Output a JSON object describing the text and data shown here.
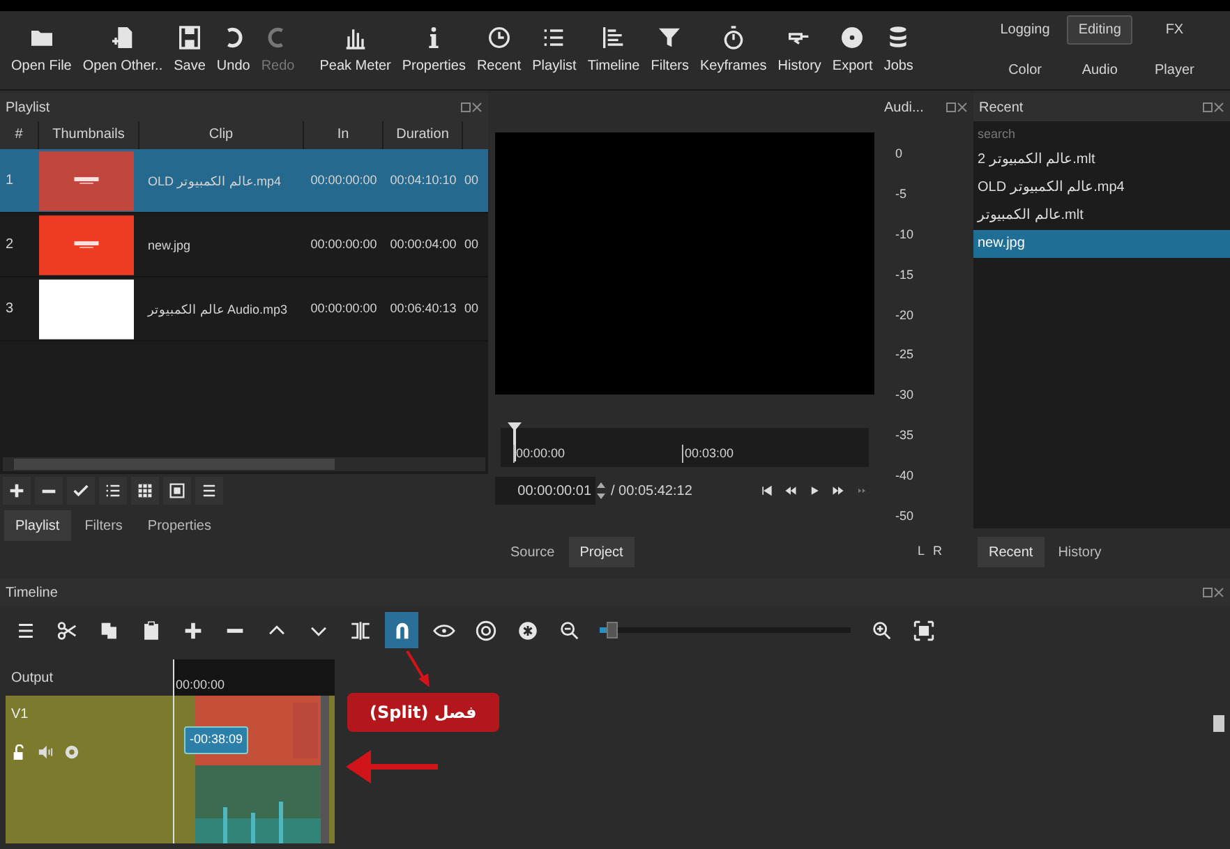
{
  "toolbar": [
    {
      "label": "Open File",
      "disabled": false
    },
    {
      "label": "Open Other..",
      "disabled": false
    },
    {
      "label": "Save",
      "disabled": false
    },
    {
      "label": "Undo",
      "disabled": false
    },
    {
      "label": "Redo",
      "disabled": true
    },
    {
      "label": "Peak Meter",
      "disabled": false
    },
    {
      "label": "Properties",
      "disabled": false
    },
    {
      "label": "Recent",
      "disabled": false
    },
    {
      "label": "Playlist",
      "disabled": false
    },
    {
      "label": "Timeline",
      "disabled": false
    },
    {
      "label": "Filters",
      "disabled": false
    },
    {
      "label": "Keyframes",
      "disabled": false
    },
    {
      "label": "History",
      "disabled": false
    },
    {
      "label": "Export",
      "disabled": false
    },
    {
      "label": "Jobs",
      "disabled": false
    }
  ],
  "layouts": [
    {
      "label": "Logging",
      "selected": false
    },
    {
      "label": "Editing",
      "selected": true
    },
    {
      "label": "FX",
      "selected": false
    },
    {
      "label": "Color",
      "selected": false
    },
    {
      "label": "Audio",
      "selected": false
    },
    {
      "label": "Player",
      "selected": false
    }
  ],
  "playlist": {
    "title": "Playlist",
    "columns": [
      "#",
      "Thumbnails",
      "Clip",
      "In",
      "Duration"
    ],
    "rows": [
      {
        "number": "1",
        "clip": "OLD عالم الكمبيوتر.mp4",
        "in": "00:00:00:00",
        "duration": "00:04:10:10",
        "column_6": "00",
        "selected": true
      },
      {
        "number": "2",
        "clip": "new.jpg",
        "in": "00:00:00:00",
        "duration": "00:00:04:00",
        "column_6": "00",
        "selected": false
      },
      {
        "number": "3",
        "clip": "عالم الكمبيوتر Audio.mp3",
        "in": "00:00:00:00",
        "duration": "00:06:40:13",
        "column_6": "00",
        "selected": false
      }
    ],
    "tabs": [
      {
        "label": "Playlist",
        "selected": true
      },
      {
        "label": "Filters",
        "selected": false
      },
      {
        "label": "Properties",
        "selected": false
      }
    ]
  },
  "viewer": {
    "ruler": [
      "00:00:00",
      "00:03:00"
    ],
    "timecode": "00:00:00:01",
    "total": "/ 00:05:42:12",
    "tabs": [
      {
        "label": "Source",
        "selected": false
      },
      {
        "label": "Project",
        "selected": true
      }
    ]
  },
  "audio_meter": {
    "title": "Audi...",
    "scale": [
      "0",
      "-5",
      "-10",
      "-15",
      "-20",
      "-25",
      "-30",
      "-35",
      "-40",
      "-50"
    ],
    "channels": [
      "L",
      "R"
    ]
  },
  "recent": {
    "title": "Recent",
    "search": {
      "placeholder": "search"
    },
    "items": [
      {
        "label": "عالم الكمبيوتر 2.mlt",
        "selected": false
      },
      {
        "label": "OLD عالم الكمبيوتر.mp4",
        "selected": false
      },
      {
        "label": "عالم الكمبيوتر.mlt",
        "selected": false
      },
      {
        "label": "new.jpg",
        "selected": true
      }
    ],
    "tabs": [
      {
        "label": "Recent",
        "selected": true
      },
      {
        "label": "History",
        "selected": false
      }
    ]
  },
  "timeline": {
    "title": "Timeline",
    "tools": [
      {
        "selected": false
      },
      {
        "selected": false
      },
      {
        "selected": false
      },
      {
        "selected": false
      },
      {
        "selected": false
      },
      {
        "selected": false
      },
      {
        "selected": false
      },
      {
        "selected": false
      },
      {
        "selected": false
      },
      {
        "selected": true
      },
      {
        "selected": false
      },
      {
        "selected": false
      },
      {
        "selected": false
      },
      {
        "selected": false
      }
    ],
    "zoom": {
      "level": 0.03
    },
    "output_label": "Output",
    "time": "00:00:00",
    "track": {
      "name": "V1",
      "tooltip": "-00:38:09"
    }
  },
  "annotation": {
    "text": "فصل (Split)"
  }
}
